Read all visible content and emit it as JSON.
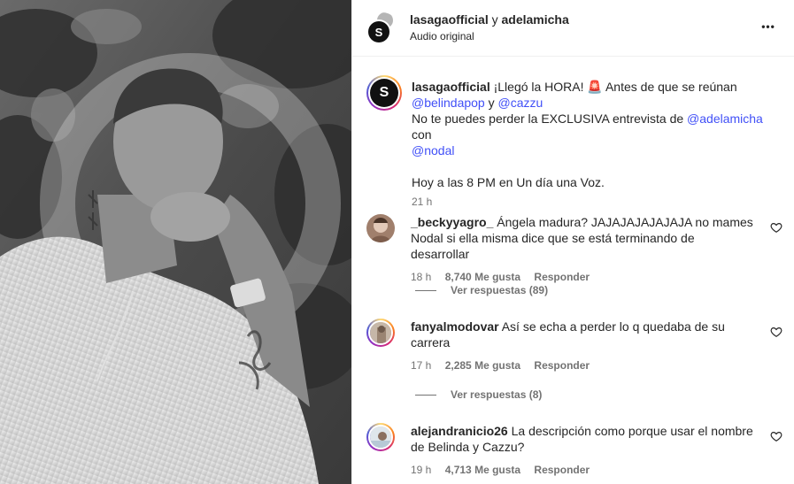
{
  "header": {
    "user1": "lasagaofficial",
    "sep": "y",
    "user2": "adelamicha",
    "subtitle": "Audio original",
    "more": "•••",
    "logo_letter": "S"
  },
  "caption": {
    "username": "lasagaofficial",
    "text1": "¡Llegó la HORA! 🚨 Antes de que se reúnan",
    "mention1": "@belindapop",
    "and": "y",
    "mention2": "@cazzu",
    "text2": "No te puedes perder la EXCLUSIVA entrevista de",
    "mention3": "@adelamicha",
    "con": "con",
    "mention4": "@nodal",
    "text3": "Hoy a las 8 PM en Un día una Voz.",
    "time": "21 h"
  },
  "comments": [
    {
      "username": "_beckyyagro_",
      "text_line1": "Ángela madura? JAJAJAJAJAJAJA no mames",
      "text_line2": "Nodal si ella misma dice que se está terminando de desarrollar",
      "time": "18 h",
      "likes": "8,740 Me gusta",
      "reply": "Responder",
      "view_replies": "Ver respuestas (89)"
    },
    {
      "username": "fanyalmodovar",
      "text_line1": "Así se echa a perder lo q quedaba de su",
      "text_line2": "carrera",
      "time": "17 h",
      "likes": "2,285 Me gusta",
      "reply": "Responder",
      "view_replies": "Ver respuestas (8)"
    },
    {
      "username": "alejandranicio26",
      "text_line1": "La descripción como porque usar el nombre",
      "text_line2": "de Belinda y Cazzu?",
      "time": "19 h",
      "likes": "4,713 Me gusta",
      "reply": "Responder"
    }
  ],
  "colors": {
    "mention": "#4150f7",
    "meta": "#737373",
    "text": "#262626"
  }
}
